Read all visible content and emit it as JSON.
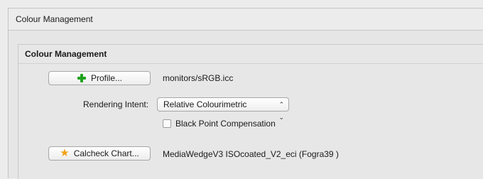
{
  "window": {
    "title": "Colour Management"
  },
  "group": {
    "title": "Colour Management"
  },
  "profile": {
    "button_label": "Profile...",
    "value": "monitors/sRGB.icc"
  },
  "rendering_intent": {
    "label": "Rendering Intent:",
    "selected": "Relative Colourimetric",
    "arrow": "⌃⌄"
  },
  "black_point": {
    "label": "Black Point Compensation",
    "checked": false
  },
  "calcheck": {
    "button_label": "Calcheck Chart...",
    "value": "MediaWedgeV3  ISOcoated_V2_eci (Fogra39 )"
  },
  "icons": {
    "profile": "plus-icon",
    "calcheck": "star-icon"
  },
  "colors": {
    "plus": "#1fa21f",
    "star": "#f2a014"
  }
}
